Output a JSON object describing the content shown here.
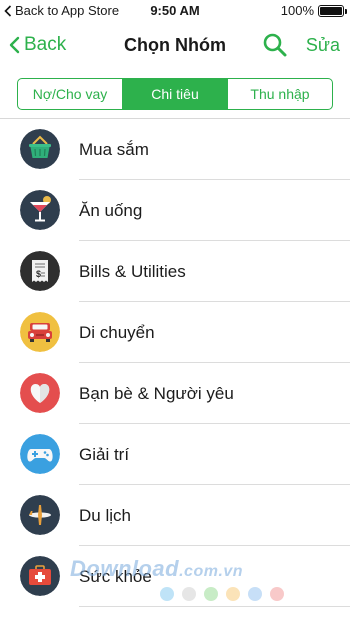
{
  "status_bar": {
    "back_app": "Back to App Store",
    "time": "9:50 AM",
    "battery": "100%"
  },
  "nav": {
    "back_label": "Back",
    "title": "Chọn Nhóm",
    "edit_label": "Sửa"
  },
  "tabs": [
    {
      "label": "Nợ/Cho vay",
      "active": false
    },
    {
      "label": "Chi tiêu",
      "active": true
    },
    {
      "label": "Thu nhập",
      "active": false
    }
  ],
  "categories": [
    {
      "label": "Mua sắm",
      "icon": "shopping-basket-icon",
      "color": "#2f3e4e"
    },
    {
      "label": "Ăn uống",
      "icon": "cocktail-glass-icon",
      "color": "#2f3e4e"
    },
    {
      "label": "Bills & Utilities",
      "icon": "bill-receipt-icon",
      "color": "#2f2f2f"
    },
    {
      "label": "Di chuyển",
      "icon": "car-icon",
      "color": "#f0c040"
    },
    {
      "label": "Bạn bè & Người yêu",
      "icon": "heart-icon",
      "color": "#e44e4e"
    },
    {
      "label": "Giải trí",
      "icon": "gamepad-icon",
      "color": "#3aa0e0"
    },
    {
      "label": "Du lịch",
      "icon": "airplane-icon",
      "color": "#2f3e4e"
    },
    {
      "label": "Sức khỏe",
      "icon": "first-aid-kit-icon",
      "color": "#2f3e4e"
    }
  ],
  "watermark": {
    "text": "Download",
    "domain": ".com.vn"
  },
  "colors": {
    "accent": "#2db14c",
    "separator": "#dcdcdc"
  }
}
